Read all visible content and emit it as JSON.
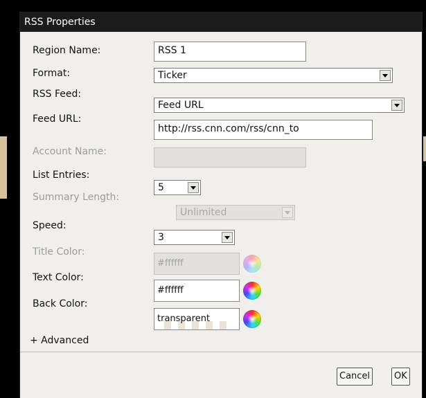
{
  "dialog": {
    "title": "RSS Properties",
    "fields": {
      "region_name": {
        "label": "Region Name:",
        "value": "RSS 1"
      },
      "format": {
        "label": "Format:",
        "value": "Ticker"
      },
      "rss_feed": {
        "label": "RSS Feed:",
        "value": "Feed URL"
      },
      "feed_url": {
        "label": "Feed URL:",
        "value": "http://rss.cnn.com/rss/cnn_to"
      },
      "account_name": {
        "label": "Account Name:",
        "value": ""
      },
      "list_entries": {
        "label": "List Entries:",
        "value": "5"
      },
      "summary_length": {
        "label": "Summary Length:",
        "value": "Unlimited"
      },
      "speed": {
        "label": "Speed:",
        "value": "3"
      },
      "title_color": {
        "label": "Title Color:",
        "value": "#ffffff"
      },
      "text_color": {
        "label": "Text Color:",
        "value": "#ffffff"
      },
      "back_color": {
        "label": "Back Color:",
        "value": "transparent"
      }
    },
    "advanced_label": "+ Advanced",
    "buttons": {
      "cancel": "Cancel",
      "ok": "OK"
    }
  },
  "colors": {
    "titlebar": "#1b1b1b",
    "dialog_bg": "#f0efeb",
    "disabled_text": "#9c9c9c"
  }
}
